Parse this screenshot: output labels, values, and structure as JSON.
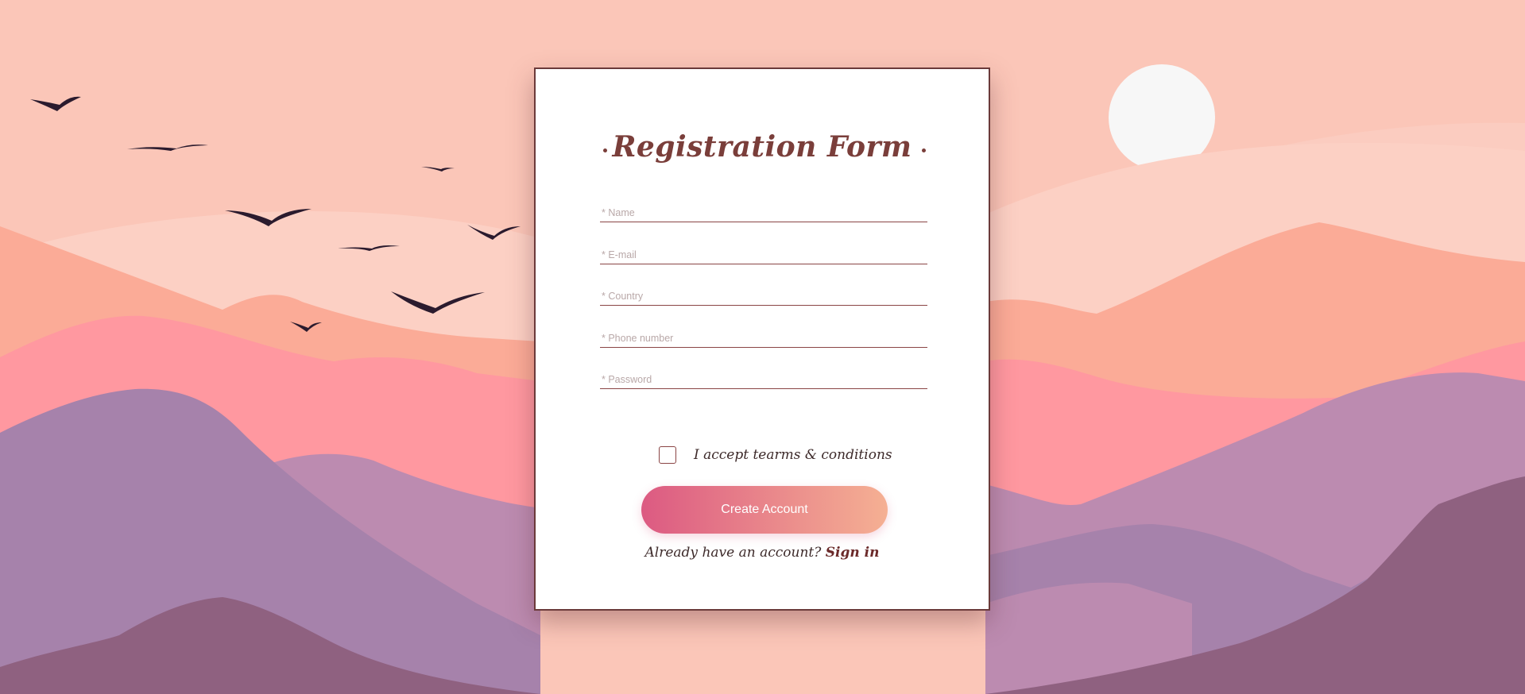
{
  "form": {
    "title": "Registration Form",
    "fields": [
      {
        "name": "name",
        "placeholder": "* Name",
        "value": ""
      },
      {
        "name": "email",
        "placeholder": "* E-mail",
        "value": ""
      },
      {
        "name": "country",
        "placeholder": "* Country",
        "value": ""
      },
      {
        "name": "phone",
        "placeholder": "* Phone number",
        "value": ""
      },
      {
        "name": "password",
        "placeholder": "* Password",
        "value": ""
      }
    ],
    "terms_label": "I accept tearms & conditions",
    "terms_checked": false,
    "submit_label": "Create Account",
    "signin_prompt": "Already have an account?",
    "signin_link": "Sign in"
  },
  "background": {
    "sky": "#fbc6b8",
    "sun": "#f7f7f7",
    "bird": "#2b1b2e",
    "layers": [
      "#fcd0c4",
      "#fbab97",
      "#ff98a0",
      "#bc8bb0",
      "#a682ab",
      "#8f6180"
    ]
  },
  "colors": {
    "accent": "#7a3e3a",
    "button_start": "#dc5a82",
    "button_end": "#f5b093"
  }
}
